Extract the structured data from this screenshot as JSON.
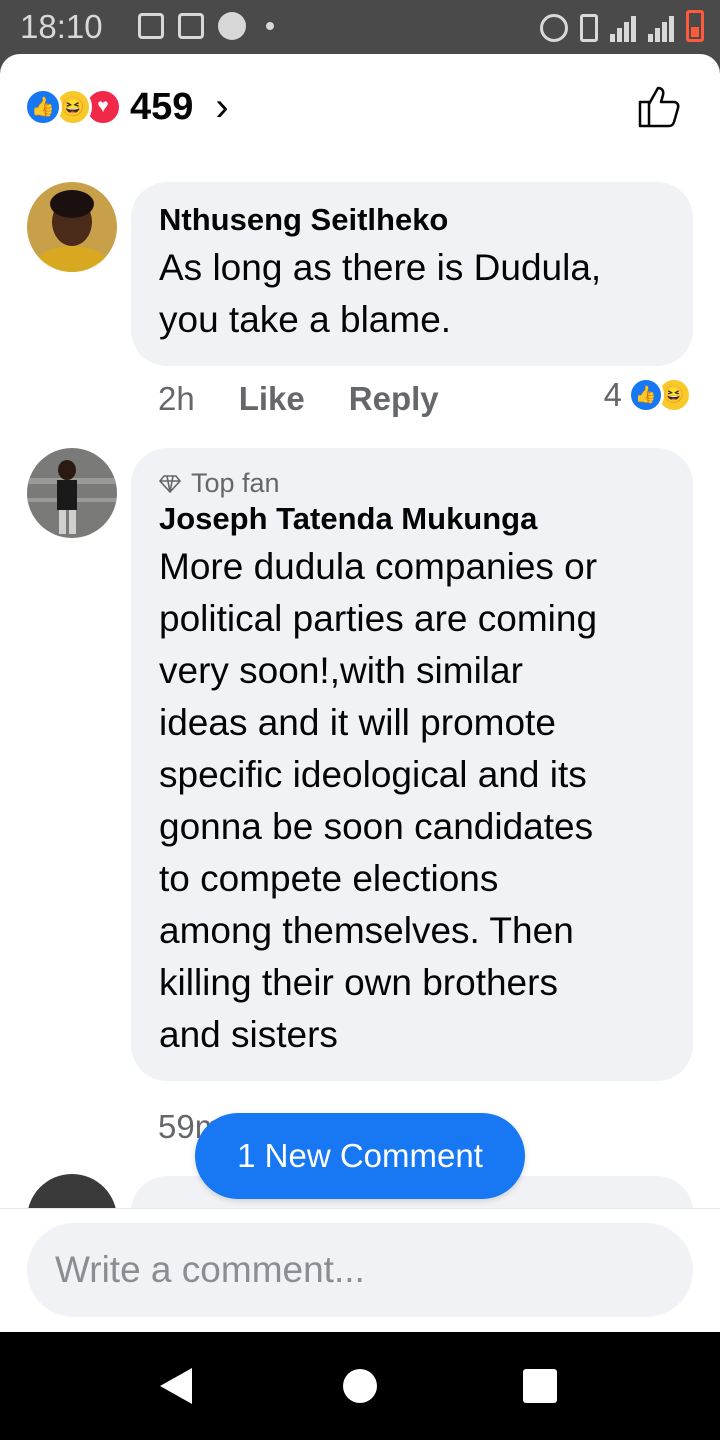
{
  "status_bar": {
    "time": "18:10"
  },
  "reactions": {
    "count": "459",
    "types": [
      "like-icon",
      "haha-icon",
      "love-icon"
    ]
  },
  "comments": [
    {
      "author": "Nthuseng Seitlheko",
      "lines": [
        "As long as there is Dudula,",
        "you take a blame."
      ],
      "time": "2h",
      "like_label": "Like",
      "reply_label": "Reply",
      "reaction_count": "4"
    },
    {
      "badge": "Top fan",
      "author": "Joseph Tatenda Mukunga",
      "lines": [
        "More dudula companies or",
        "political parties are coming",
        "very soon!,with similar",
        "ideas and it will promote",
        "specific ideological and its",
        "gonna be soon candidates",
        "to compete elections",
        "among themselves. Then",
        "killing their own brothers",
        "and sisters"
      ],
      "time": "59m"
    }
  ],
  "new_comment_label": "1 New Comment",
  "composer": {
    "placeholder": "Write a comment..."
  },
  "colors": {
    "accent": "#1877f2",
    "bubble": "#f0f2f5",
    "meta_text": "#65676b"
  }
}
